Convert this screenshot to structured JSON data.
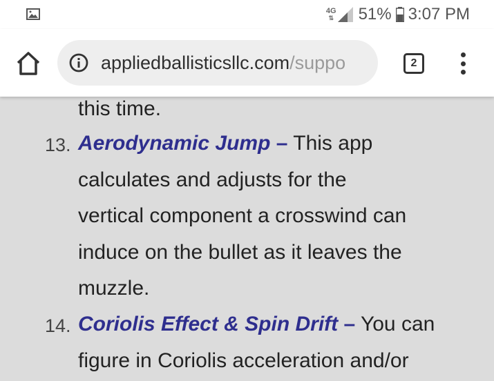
{
  "status_bar": {
    "network": "4G",
    "battery_percent": "51%",
    "time": "3:07 PM",
    "icons": [
      "image-icon",
      "signal-icon",
      "battery-icon"
    ]
  },
  "browser": {
    "url_domain": "appliedballisticsllc.com",
    "url_path": "/suppo",
    "tab_count": "2",
    "icons": [
      "home-icon",
      "info-icon",
      "tab-switcher-icon",
      "overflow-menu-icon"
    ]
  },
  "article": {
    "previous_tail": "this time.",
    "items": [
      {
        "number": "13.",
        "title": "Aerodynamic Jump",
        "dash": " –",
        "lines": [
          " This app",
          "calculates and adjusts for the",
          "vertical component a crosswind can",
          "induce on the bullet as it leaves the",
          "muzzle."
        ]
      },
      {
        "number": "14.",
        "title": "Coriolis Effect & Spin Drift",
        "dash": " –",
        "lines": [
          " You can",
          "figure in Coriolis acceleration and/or"
        ]
      }
    ]
  },
  "colors": {
    "link_title": "#2e2e8e",
    "body_text": "#222222",
    "page_background": "#dcdcdc"
  }
}
